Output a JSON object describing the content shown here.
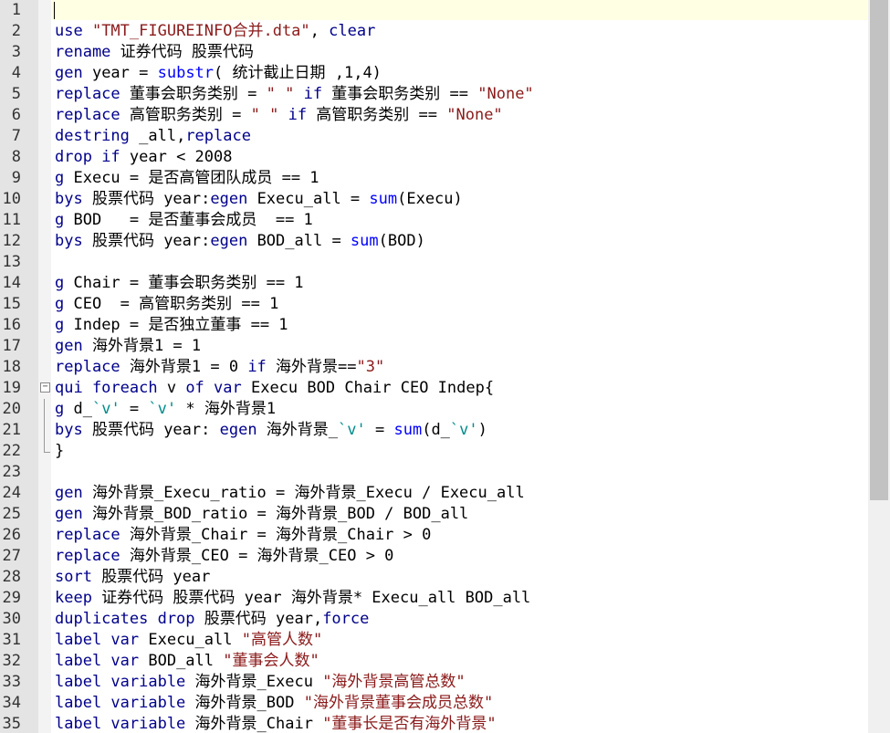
{
  "editor": {
    "lines": [
      {
        "n": "1",
        "t": []
      },
      {
        "n": "2",
        "t": [
          {
            "c": "cmd",
            "s": "use "
          },
          {
            "c": "str",
            "s": "\"TMT_FIGUREINFO合并.dta\""
          },
          {
            "c": "",
            "s": ", "
          },
          {
            "c": "kw",
            "s": "clear"
          }
        ]
      },
      {
        "n": "3",
        "t": [
          {
            "c": "cmd",
            "s": "rename "
          },
          {
            "c": "",
            "s": "证券代码 股票代码"
          }
        ]
      },
      {
        "n": "4",
        "t": [
          {
            "c": "cmd",
            "s": "gen "
          },
          {
            "c": "",
            "s": "year = "
          },
          {
            "c": "fn",
            "s": "substr"
          },
          {
            "c": "",
            "s": "( 统计截止日期 ,1,4)"
          }
        ]
      },
      {
        "n": "5",
        "t": [
          {
            "c": "cmd",
            "s": "replace "
          },
          {
            "c": "",
            "s": "董事会职务类别 = "
          },
          {
            "c": "str",
            "s": "\" \""
          },
          {
            "c": "",
            "s": " "
          },
          {
            "c": "kw",
            "s": "if"
          },
          {
            "c": "",
            "s": " 董事会职务类别 == "
          },
          {
            "c": "str",
            "s": "\"None\""
          }
        ]
      },
      {
        "n": "6",
        "t": [
          {
            "c": "cmd",
            "s": "replace "
          },
          {
            "c": "",
            "s": "高管职务类别 = "
          },
          {
            "c": "str",
            "s": "\" \""
          },
          {
            "c": "",
            "s": " "
          },
          {
            "c": "kw",
            "s": "if"
          },
          {
            "c": "",
            "s": " 高管职务类别 == "
          },
          {
            "c": "str",
            "s": "\"None\""
          }
        ]
      },
      {
        "n": "7",
        "t": [
          {
            "c": "cmd",
            "s": "destring "
          },
          {
            "c": "",
            "s": "_all,"
          },
          {
            "c": "kw",
            "s": "replace"
          }
        ]
      },
      {
        "n": "8",
        "t": [
          {
            "c": "cmd",
            "s": "drop "
          },
          {
            "c": "kw",
            "s": "if"
          },
          {
            "c": "",
            "s": " year < 2008"
          }
        ]
      },
      {
        "n": "9",
        "t": [
          {
            "c": "cmd",
            "s": "g "
          },
          {
            "c": "",
            "s": "Execu = 是否高管团队成员 == 1"
          }
        ]
      },
      {
        "n": "10",
        "t": [
          {
            "c": "cmd",
            "s": "bys "
          },
          {
            "c": "",
            "s": "股票代码 year:"
          },
          {
            "c": "cmd",
            "s": "egen"
          },
          {
            "c": "",
            "s": " Execu_all = "
          },
          {
            "c": "fn",
            "s": "sum"
          },
          {
            "c": "",
            "s": "(Execu)"
          }
        ]
      },
      {
        "n": "11",
        "t": [
          {
            "c": "cmd",
            "s": "g "
          },
          {
            "c": "",
            "s": "BOD   = 是否董事会成员  == 1"
          }
        ]
      },
      {
        "n": "12",
        "t": [
          {
            "c": "cmd",
            "s": "bys "
          },
          {
            "c": "",
            "s": "股票代码 year:"
          },
          {
            "c": "cmd",
            "s": "egen"
          },
          {
            "c": "",
            "s": " BOD_all = "
          },
          {
            "c": "fn",
            "s": "sum"
          },
          {
            "c": "",
            "s": "(BOD)"
          }
        ]
      },
      {
        "n": "13",
        "t": []
      },
      {
        "n": "14",
        "t": [
          {
            "c": "cmd",
            "s": "g "
          },
          {
            "c": "",
            "s": "Chair = 董事会职务类别 == 1"
          }
        ]
      },
      {
        "n": "15",
        "t": [
          {
            "c": "cmd",
            "s": "g "
          },
          {
            "c": "",
            "s": "CEO  = 高管职务类别 == 1"
          }
        ]
      },
      {
        "n": "16",
        "t": [
          {
            "c": "cmd",
            "s": "g "
          },
          {
            "c": "",
            "s": "Indep = 是否独立董事 == 1"
          }
        ]
      },
      {
        "n": "17",
        "t": [
          {
            "c": "cmd",
            "s": "gen "
          },
          {
            "c": "",
            "s": "海外背景1 = 1"
          }
        ]
      },
      {
        "n": "18",
        "t": [
          {
            "c": "cmd",
            "s": "replace "
          },
          {
            "c": "",
            "s": "海外背景1 = 0 "
          },
          {
            "c": "kw",
            "s": "if"
          },
          {
            "c": "",
            "s": " 海外背景=="
          },
          {
            "c": "str",
            "s": "\"3\""
          }
        ]
      },
      {
        "n": "19",
        "fold": "open",
        "t": [
          {
            "c": "cmd",
            "s": "qui foreach "
          },
          {
            "c": "",
            "s": "v "
          },
          {
            "c": "kw",
            "s": "of var"
          },
          {
            "c": "",
            "s": " Execu BOD Chair CEO Indep{"
          }
        ]
      },
      {
        "n": "20",
        "fold": "line",
        "t": [
          {
            "c": "cmd",
            "s": "g "
          },
          {
            "c": "",
            "s": "d_"
          },
          {
            "c": "mac",
            "s": "`v'"
          },
          {
            "c": "",
            "s": " = "
          },
          {
            "c": "mac",
            "s": "`v'"
          },
          {
            "c": "",
            "s": " * 海外背景1"
          }
        ]
      },
      {
        "n": "21",
        "fold": "line",
        "t": [
          {
            "c": "cmd",
            "s": "bys "
          },
          {
            "c": "",
            "s": "股票代码 year: "
          },
          {
            "c": "cmd",
            "s": "egen"
          },
          {
            "c": "",
            "s": " 海外背景_"
          },
          {
            "c": "mac",
            "s": "`v'"
          },
          {
            "c": "",
            "s": " = "
          },
          {
            "c": "fn",
            "s": "sum"
          },
          {
            "c": "",
            "s": "(d_"
          },
          {
            "c": "mac",
            "s": "`v'"
          },
          {
            "c": "",
            "s": ")"
          }
        ]
      },
      {
        "n": "22",
        "fold": "end",
        "t": [
          {
            "c": "",
            "s": "}"
          }
        ]
      },
      {
        "n": "23",
        "t": []
      },
      {
        "n": "24",
        "t": [
          {
            "c": "cmd",
            "s": "gen "
          },
          {
            "c": "",
            "s": "海外背景_Execu_ratio = 海外背景_Execu / Execu_all"
          }
        ]
      },
      {
        "n": "25",
        "t": [
          {
            "c": "cmd",
            "s": "gen "
          },
          {
            "c": "",
            "s": "海外背景_BOD_ratio = 海外背景_BOD / BOD_all"
          }
        ]
      },
      {
        "n": "26",
        "t": [
          {
            "c": "cmd",
            "s": "replace "
          },
          {
            "c": "",
            "s": "海外背景_Chair = 海外背景_Chair > 0"
          }
        ]
      },
      {
        "n": "27",
        "t": [
          {
            "c": "cmd",
            "s": "replace "
          },
          {
            "c": "",
            "s": "海外背景_CEO = 海外背景_CEO > 0"
          }
        ]
      },
      {
        "n": "28",
        "t": [
          {
            "c": "cmd",
            "s": "sort "
          },
          {
            "c": "",
            "s": "股票代码 year"
          }
        ]
      },
      {
        "n": "29",
        "t": [
          {
            "c": "cmd",
            "s": "keep "
          },
          {
            "c": "",
            "s": "证券代码 股票代码 year 海外背景* Execu_all BOD_all"
          }
        ]
      },
      {
        "n": "30",
        "t": [
          {
            "c": "cmd",
            "s": "duplicates drop "
          },
          {
            "c": "",
            "s": "股票代码 year,"
          },
          {
            "c": "kw",
            "s": "force"
          }
        ]
      },
      {
        "n": "31",
        "t": [
          {
            "c": "cmd",
            "s": "label var "
          },
          {
            "c": "",
            "s": "Execu_all "
          },
          {
            "c": "str",
            "s": "\"高管人数\""
          }
        ]
      },
      {
        "n": "32",
        "t": [
          {
            "c": "cmd",
            "s": "label var "
          },
          {
            "c": "",
            "s": "BOD_all "
          },
          {
            "c": "str",
            "s": "\"董事会人数\""
          }
        ]
      },
      {
        "n": "33",
        "t": [
          {
            "c": "cmd",
            "s": "label variable "
          },
          {
            "c": "",
            "s": "海外背景_Execu "
          },
          {
            "c": "str",
            "s": "\"海外背景高管总数\""
          }
        ]
      },
      {
        "n": "34",
        "t": [
          {
            "c": "cmd",
            "s": "label variable "
          },
          {
            "c": "",
            "s": "海外背景_BOD "
          },
          {
            "c": "str",
            "s": "\"海外背景董事会成员总数\""
          }
        ]
      },
      {
        "n": "35",
        "t": [
          {
            "c": "cmd",
            "s": "label variable "
          },
          {
            "c": "",
            "s": "海外背景_Chair "
          },
          {
            "c": "str",
            "s": "\"董事长是否有海外背景\""
          }
        ]
      }
    ]
  },
  "colors": {
    "command": "#00008b",
    "function": "#0000ff",
    "string": "#8b1a1a",
    "macro": "#008b8b",
    "gutter": "#e4e4e4",
    "current_line": "#ffffe4"
  }
}
